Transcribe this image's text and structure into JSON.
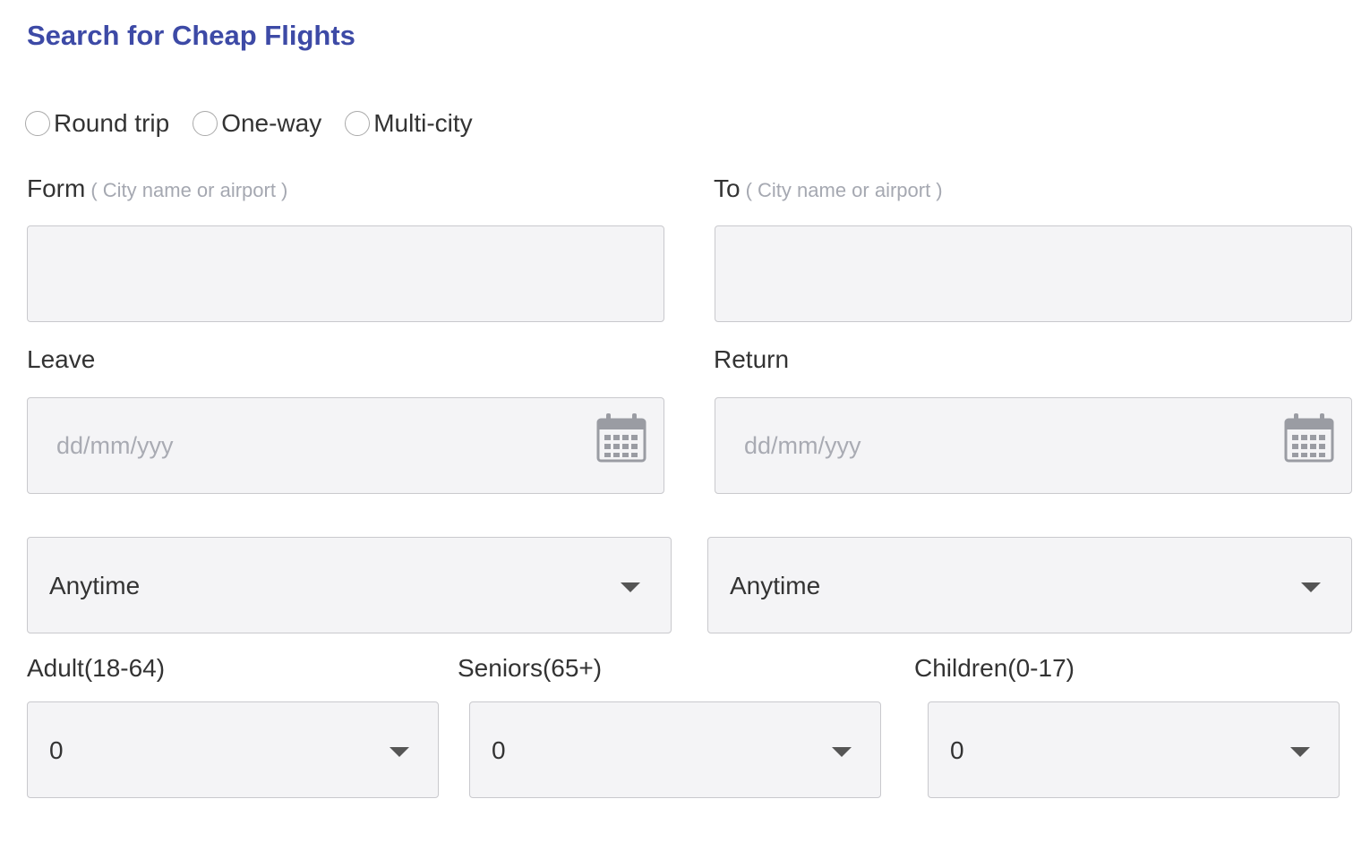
{
  "title": "Search for Cheap Flights",
  "trip_types": [
    "Round trip",
    "One-way",
    "Multi-city"
  ],
  "from": {
    "label": "Form",
    "hint": "( City name or airport )",
    "value": ""
  },
  "to": {
    "label": "To",
    "hint": "( City name or airport )",
    "value": ""
  },
  "leave": {
    "label": "Leave",
    "placeholder": "dd/mm/yyy"
  },
  "return": {
    "label": "Return",
    "placeholder": "dd/mm/yyy"
  },
  "leave_time": {
    "value": "Anytime"
  },
  "return_time": {
    "value": "Anytime"
  },
  "passengers": {
    "adult": {
      "label": "Adult(18-64)",
      "value": "0"
    },
    "seniors": {
      "label": "Seniors(65+)",
      "value": "0"
    },
    "children": {
      "label": "Children(0-17)",
      "value": "0"
    }
  },
  "colors": {
    "title": "#3d4aa6",
    "field_bg": "#f4f4f6",
    "field_border": "#c9c9cd",
    "placeholder": "#a9abb3"
  },
  "icons": {
    "date": "calendar-icon",
    "select": "chevron-down-icon"
  }
}
